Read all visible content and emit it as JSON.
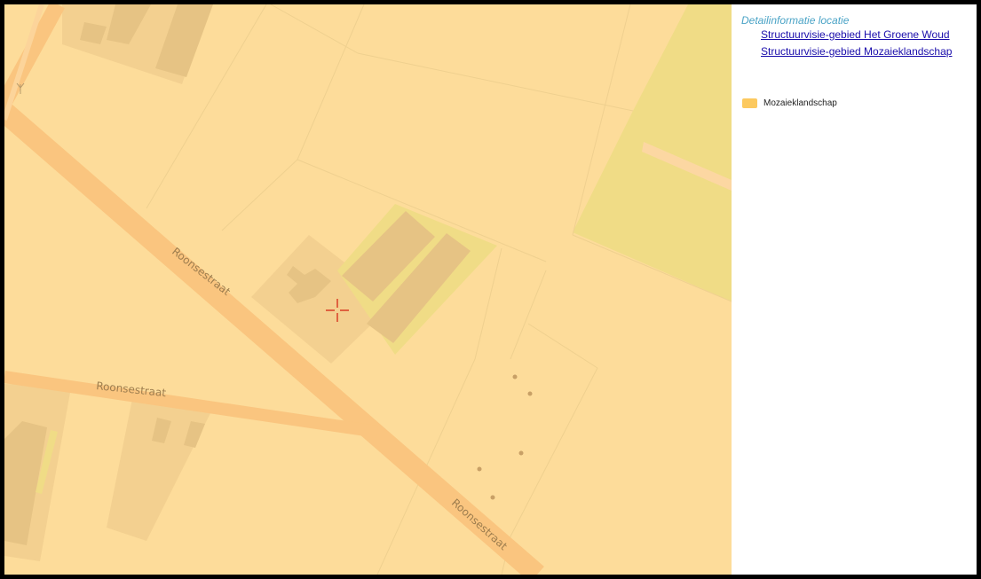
{
  "info_panel": {
    "title": "Detailinformatie locatie",
    "links": [
      {
        "label": "Structuurvisie-gebied Het Groene Woud"
      },
      {
        "label": "Structuurvisie-gebied Mozaiekland­schap"
      }
    ]
  },
  "legend": {
    "items": [
      {
        "label": "Mozaieklandschap",
        "color": "#fcc95f"
      }
    ]
  },
  "map": {
    "street_labels": [
      "Roonsestraat",
      "Roonsestraat",
      "Roonsestraat"
    ],
    "colors": {
      "base": "#fddc9a",
      "road": "#fac57f",
      "parcel_line": "#efd08f",
      "yard": "#f3d090",
      "building": "#e6c384",
      "green_zone": "#f0dc86",
      "marker": "#d21a0a"
    },
    "marker_icon": "crosshair-icon",
    "symbol_icon": "tree-symbol-icon"
  }
}
